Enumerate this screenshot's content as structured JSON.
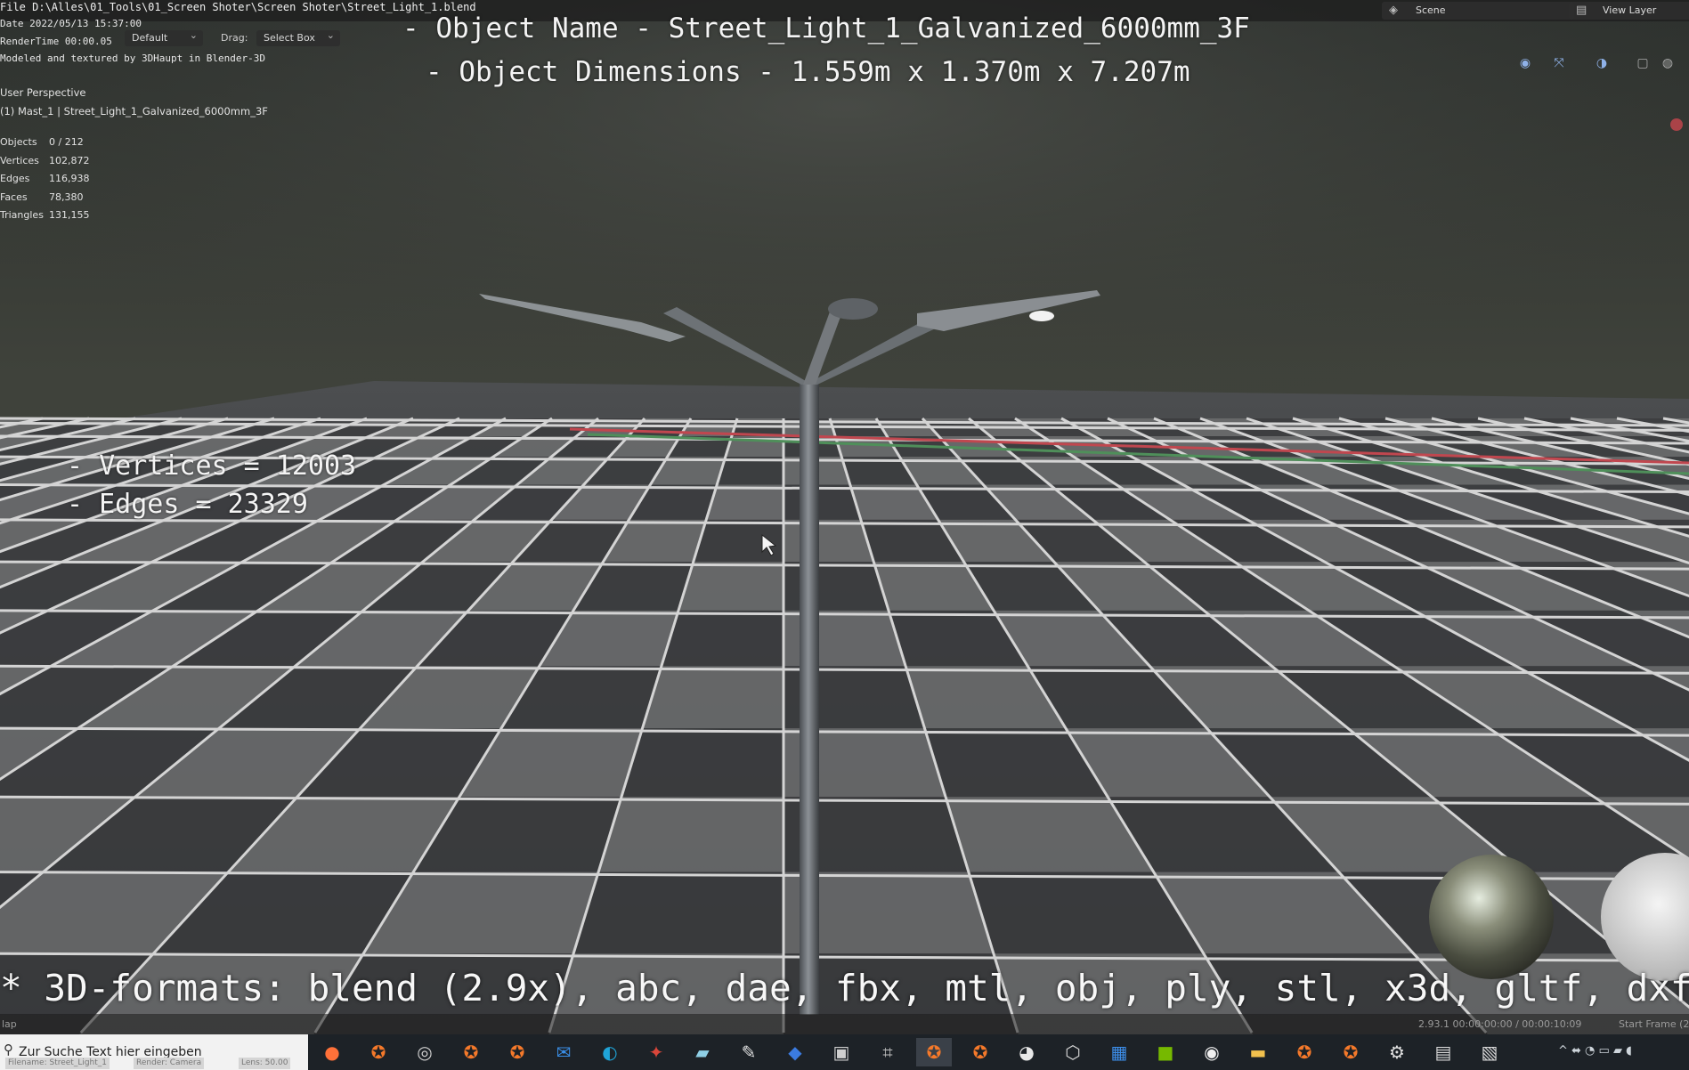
{
  "header": {
    "file_path": "File D:\\Alles\\01_Tools\\01_Screen Shoter\\Screen Shoter\\Street_Light_1.blend",
    "date": "Date 2022/05/13 15:37:00",
    "render_time": "RenderTime 00:00.05",
    "credit": "Modeled and textured by 3DHaupt in Blender-3D",
    "orientation_value": "Default",
    "drag_label": "Drag:",
    "drag_value": "Select Box",
    "scene_label": "Scene",
    "view_layer_label": "View Layer"
  },
  "viewport": {
    "perspective": "User Perspective",
    "active_object": "(1) Mast_1 | Street_Light_1_Galvanized_6000mm_3F",
    "stats": [
      {
        "key": "Objects",
        "value": "0 / 212"
      },
      {
        "key": "Vertices",
        "value": "102,872"
      },
      {
        "key": "Edges",
        "value": "116,938"
      },
      {
        "key": "Faces",
        "value": "78,380"
      },
      {
        "key": "Triangles",
        "value": "131,155"
      }
    ]
  },
  "overlay": {
    "object_name_line": "- Object Name - Street_Light_1_Galvanized_6000mm_3F",
    "dimensions_line": "- Object Dimensions -  1.559m x 1.370m x 7.207m",
    "vertices_line": "- Vertices = 12003",
    "edges_line": "- Edges = 23329",
    "formats_line": "* 3D-formats: blend (2.9x), abc, dae, fbx, mtl, obj, ply, stl, x3d, gltf, dxf"
  },
  "statusbar": {
    "left": "lap",
    "version_info": "2.93.1   00:00:00:00 / 00:00:10:09",
    "start_frame": "Start Frame (2"
  },
  "taskbar": {
    "search_placeholder": "Zur Suche Text hier eingeben",
    "ghost_labels": [
      "Filename: Street_Light_1",
      "Render: Camera",
      "Lens: 50.00"
    ],
    "apps": [
      {
        "name": "firefox",
        "glyph": "●",
        "color": "#ff7139"
      },
      {
        "name": "blender",
        "glyph": "✪",
        "color": "#f5792a"
      },
      {
        "name": "obs",
        "glyph": "◎",
        "color": "#cfcfcf"
      },
      {
        "name": "blender",
        "glyph": "✪",
        "color": "#f5792a"
      },
      {
        "name": "blender",
        "glyph": "✪",
        "color": "#f5792a"
      },
      {
        "name": "mail",
        "glyph": "✉",
        "color": "#3a8ee6"
      },
      {
        "name": "edge",
        "glyph": "◐",
        "color": "#1fa4d8"
      },
      {
        "name": "tool",
        "glyph": "✦",
        "color": "#d9463a"
      },
      {
        "name": "notes",
        "glyph": "▰",
        "color": "#8fd0e6"
      },
      {
        "name": "paint",
        "glyph": "✎",
        "color": "#e0e0e0"
      },
      {
        "name": "app",
        "glyph": "◆",
        "color": "#3b7be0"
      },
      {
        "name": "terminal",
        "glyph": "▣",
        "color": "#cfcfcf"
      },
      {
        "name": "capture",
        "glyph": "⌗",
        "color": "#bfbfbf"
      },
      {
        "name": "blender-active",
        "glyph": "✪",
        "color": "#f5792a"
      },
      {
        "name": "blender",
        "glyph": "✪",
        "color": "#f5792a"
      },
      {
        "name": "panda",
        "glyph": "◕",
        "color": "#e8e8e8"
      },
      {
        "name": "3d-viewer",
        "glyph": "⬡",
        "color": "#d8d8d8"
      },
      {
        "name": "calendar",
        "glyph": "▦",
        "color": "#3c8de8"
      },
      {
        "name": "nvidia",
        "glyph": "■",
        "color": "#76b900"
      },
      {
        "name": "media",
        "glyph": "◉",
        "color": "#f0f0f0"
      },
      {
        "name": "explorer",
        "glyph": "▬",
        "color": "#f2c14e"
      },
      {
        "name": "blender",
        "glyph": "✪",
        "color": "#f5792a"
      },
      {
        "name": "blender",
        "glyph": "✪",
        "color": "#f5792a"
      },
      {
        "name": "settings",
        "glyph": "⚙",
        "color": "#e0e0e0"
      },
      {
        "name": "device",
        "glyph": "▤",
        "color": "#d8d8d8"
      },
      {
        "name": "window",
        "glyph": "▧",
        "color": "#d8d8d8"
      }
    ],
    "tray": "^  ⬌  ◔  ▭  ▰  ◖"
  },
  "colors": {
    "grid_dark": "#3b3c3e",
    "grid_light": "#6c6d6f",
    "grid_line": "#d4d4d4",
    "axis_x": "#c0474f",
    "axis_y": "#4f8f5a",
    "sky": "#3d3f3a"
  }
}
